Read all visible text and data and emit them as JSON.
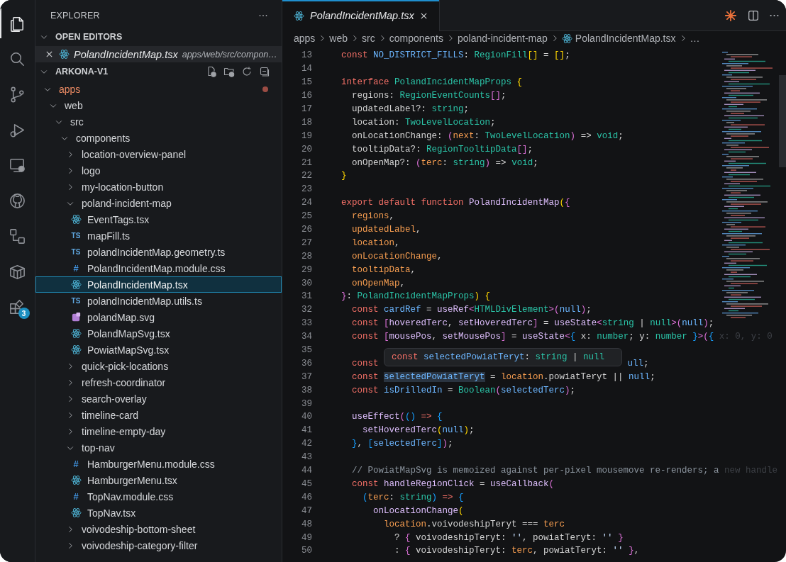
{
  "activity_bar": [
    {
      "kind": "explorer",
      "selected": true
    },
    {
      "kind": "search",
      "selected": false
    },
    {
      "kind": "source-control",
      "selected": false
    },
    {
      "kind": "run-debug",
      "selected": false
    },
    {
      "kind": "remote",
      "selected": false
    },
    {
      "kind": "github",
      "selected": false
    },
    {
      "kind": "diagram",
      "selected": false
    },
    {
      "kind": "package",
      "selected": false
    },
    {
      "kind": "extensions",
      "selected": false,
      "badge": "3"
    }
  ],
  "sidebar": {
    "title": "EXPLORER",
    "open_editors": {
      "title": "OPEN EDITORS",
      "expanded": true,
      "items": [
        {
          "name": "PolandIncidentMap.tsx",
          "path": "apps/web/src/compon…",
          "kind": "tsx"
        }
      ]
    },
    "project": {
      "title": "ARKONA-V1",
      "expanded": true,
      "tree": [
        {
          "name": "apps",
          "kind": "folder",
          "expanded": true,
          "selected": false,
          "modified": true,
          "children": [
            {
              "name": "web",
              "kind": "folder",
              "expanded": true,
              "selected": false,
              "modified": false,
              "children": [
                {
                  "name": "src",
                  "kind": "folder",
                  "expanded": true,
                  "selected": false,
                  "modified": false,
                  "children": [
                    {
                      "name": "components",
                      "kind": "folder",
                      "expanded": true,
                      "selected": false,
                      "modified": false,
                      "children": [
                        {
                          "name": "location-overview-panel",
                          "kind": "folder",
                          "expanded": false,
                          "selected": false,
                          "modified": false
                        },
                        {
                          "name": "logo",
                          "kind": "folder",
                          "expanded": false,
                          "selected": false,
                          "modified": false
                        },
                        {
                          "name": "my-location-button",
                          "kind": "folder",
                          "expanded": false,
                          "selected": false,
                          "modified": false
                        },
                        {
                          "name": "poland-incident-map",
                          "kind": "folder",
                          "expanded": true,
                          "selected": false,
                          "modified": false,
                          "children": [
                            {
                              "name": "EventTags.tsx",
                              "kind": "tsx",
                              "selected": false,
                              "modified": false
                            },
                            {
                              "name": "mapFill.ts",
                              "kind": "ts",
                              "icon_text": "TS",
                              "selected": false,
                              "modified": false
                            },
                            {
                              "name": "polandIncidentMap.geometry.ts",
                              "kind": "ts",
                              "icon_text": "TS",
                              "selected": false,
                              "modified": false
                            },
                            {
                              "name": "PolandIncidentMap.module.css",
                              "kind": "css",
                              "icon_text": "#",
                              "selected": false,
                              "modified": false
                            },
                            {
                              "name": "PolandIncidentMap.tsx",
                              "kind": "tsx",
                              "selected": true,
                              "modified": false
                            },
                            {
                              "name": "polandIncidentMap.utils.ts",
                              "kind": "ts",
                              "icon_text": "TS",
                              "selected": false,
                              "modified": false
                            },
                            {
                              "name": "polandMap.svg",
                              "kind": "svg",
                              "selected": false,
                              "modified": false
                            },
                            {
                              "name": "PolandMapSvg.tsx",
                              "kind": "tsx",
                              "selected": false,
                              "modified": false
                            },
                            {
                              "name": "PowiatMapSvg.tsx",
                              "kind": "tsx",
                              "selected": false,
                              "modified": false
                            }
                          ]
                        },
                        {
                          "name": "quick-pick-locations",
                          "kind": "folder",
                          "expanded": false,
                          "selected": false,
                          "modified": false
                        },
                        {
                          "name": "refresh-coordinator",
                          "kind": "folder",
                          "expanded": false,
                          "selected": false,
                          "modified": false
                        },
                        {
                          "name": "search-overlay",
                          "kind": "folder",
                          "expanded": false,
                          "selected": false,
                          "modified": false
                        },
                        {
                          "name": "timeline-card",
                          "kind": "folder",
                          "expanded": false,
                          "selected": false,
                          "modified": false
                        },
                        {
                          "name": "timeline-empty-day",
                          "kind": "folder",
                          "expanded": false,
                          "selected": false,
                          "modified": false
                        },
                        {
                          "name": "top-nav",
                          "kind": "folder",
                          "expanded": true,
                          "selected": false,
                          "modified": false,
                          "children": [
                            {
                              "name": "HamburgerMenu.module.css",
                              "kind": "css",
                              "icon_text": "#",
                              "selected": false,
                              "modified": false
                            },
                            {
                              "name": "HamburgerMenu.tsx",
                              "kind": "tsx",
                              "selected": false,
                              "modified": false
                            },
                            {
                              "name": "TopNav.module.css",
                              "kind": "css",
                              "icon_text": "#",
                              "selected": false,
                              "modified": false
                            },
                            {
                              "name": "TopNav.tsx",
                              "kind": "tsx",
                              "selected": false,
                              "modified": false
                            }
                          ]
                        },
                        {
                          "name": "voivodeship-bottom-sheet",
                          "kind": "folder",
                          "expanded": false,
                          "selected": false,
                          "modified": false
                        },
                        {
                          "name": "voivodeship-category-filter",
                          "kind": "folder",
                          "expanded": false,
                          "selected": false,
                          "modified": false
                        }
                      ]
                    }
                  ]
                }
              ]
            }
          ]
        }
      ]
    }
  },
  "editor": {
    "tabs": [
      {
        "name": "PolandIncidentMap.tsx",
        "kind": "tsx",
        "selected": true
      }
    ],
    "breadcrumbs": [
      {
        "text": "apps",
        "kind": "folder"
      },
      {
        "text": "web",
        "kind": "folder"
      },
      {
        "text": "src",
        "kind": "folder"
      },
      {
        "text": "components",
        "kind": "folder"
      },
      {
        "text": "poland-incident-map",
        "kind": "folder"
      },
      {
        "text": "PolandIncidentMap.tsx",
        "kind": "tsx"
      },
      {
        "text": "…",
        "kind": "more"
      }
    ],
    "lines": [
      {
        "n": "13",
        "tokens": [
          {
            "text": "const ",
            "kind": "kw"
          },
          {
            "text": "NO_DISTRICT_FILLS",
            "kind": "var"
          },
          {
            "text": ": ",
            "kind": "plain"
          },
          {
            "text": "RegionFill",
            "kind": "type"
          },
          {
            "text": "[]",
            "kind": "b1"
          },
          {
            "text": " = ",
            "kind": "plain"
          },
          {
            "text": "[]",
            "kind": "b1"
          },
          {
            "text": ";",
            "kind": "plain"
          }
        ]
      },
      {
        "n": "14"
      },
      {
        "n": "15",
        "tokens": [
          {
            "text": "interface",
            "kind": "kw"
          },
          {
            "text": " PolandIncidentMapProps",
            "kind": "type"
          },
          {
            "text": " {",
            "kind": "b1"
          }
        ]
      },
      {
        "n": "16",
        "tokens": [
          {
            "text": "  regions: ",
            "kind": "plain"
          },
          {
            "text": "RegionEventCounts",
            "kind": "type"
          },
          {
            "text": "[]",
            "kind": "b2"
          },
          {
            "text": ";",
            "kind": "plain"
          }
        ]
      },
      {
        "n": "17",
        "tokens": [
          {
            "text": "  updatedLabel?: ",
            "kind": "plain"
          },
          {
            "text": "string",
            "kind": "type"
          },
          {
            "text": ";",
            "kind": "plain"
          }
        ]
      },
      {
        "n": "18",
        "tokens": [
          {
            "text": "  location: ",
            "kind": "plain"
          },
          {
            "text": "TwoLevelLocation",
            "kind": "type"
          },
          {
            "text": ";",
            "kind": "plain"
          }
        ]
      },
      {
        "n": "19",
        "tokens": [
          {
            "text": "  onLocationChange: ",
            "kind": "plain"
          },
          {
            "text": "(",
            "kind": "b2"
          },
          {
            "text": "next",
            "kind": "param"
          },
          {
            "text": ": ",
            "kind": "plain"
          },
          {
            "text": "TwoLevelLocation",
            "kind": "type"
          },
          {
            "text": ")",
            "kind": "b2"
          },
          {
            "text": " => ",
            "kind": "plain"
          },
          {
            "text": "void",
            "kind": "type"
          },
          {
            "text": ";",
            "kind": "plain"
          }
        ]
      },
      {
        "n": "20",
        "tokens": [
          {
            "text": "  tooltipData?: ",
            "kind": "plain"
          },
          {
            "text": "RegionTooltipData",
            "kind": "type"
          },
          {
            "text": "[]",
            "kind": "b2"
          },
          {
            "text": ";",
            "kind": "plain"
          }
        ]
      },
      {
        "n": "21",
        "tokens": [
          {
            "text": "  onOpenMap?: ",
            "kind": "plain"
          },
          {
            "text": "(",
            "kind": "b2"
          },
          {
            "text": "terc",
            "kind": "param"
          },
          {
            "text": ": ",
            "kind": "plain"
          },
          {
            "text": "string",
            "kind": "type"
          },
          {
            "text": ")",
            "kind": "b2"
          },
          {
            "text": " => ",
            "kind": "plain"
          },
          {
            "text": "void",
            "kind": "type"
          },
          {
            "text": ";",
            "kind": "plain"
          }
        ]
      },
      {
        "n": "22",
        "tokens": [
          {
            "text": "}",
            "kind": "b1"
          }
        ]
      },
      {
        "n": "23"
      },
      {
        "n": "24",
        "tokens": [
          {
            "text": "export default function ",
            "kind": "kw"
          },
          {
            "text": "PolandIncidentMap",
            "kind": "fn"
          },
          {
            "text": "(",
            "kind": "b1"
          },
          {
            "text": "{",
            "kind": "b2"
          }
        ]
      },
      {
        "n": "25",
        "tokens": [
          {
            "text": "  regions",
            "kind": "param"
          },
          {
            "text": ",",
            "kind": "plain"
          }
        ]
      },
      {
        "n": "26",
        "tokens": [
          {
            "text": "  updatedLabel",
            "kind": "param"
          },
          {
            "text": ",",
            "kind": "plain"
          }
        ]
      },
      {
        "n": "27",
        "tokens": [
          {
            "text": "  location",
            "kind": "param"
          },
          {
            "text": ",",
            "kind": "plain"
          }
        ]
      },
      {
        "n": "28",
        "tokens": [
          {
            "text": "  onLocationChange",
            "kind": "param"
          },
          {
            "text": ",",
            "kind": "plain"
          }
        ]
      },
      {
        "n": "29",
        "tokens": [
          {
            "text": "  tooltipData",
            "kind": "param"
          },
          {
            "text": ",",
            "kind": "plain"
          }
        ]
      },
      {
        "n": "30",
        "tokens": [
          {
            "text": "  onOpenMap",
            "kind": "param"
          },
          {
            "text": ",",
            "kind": "plain"
          }
        ]
      },
      {
        "n": "31",
        "tokens": [
          {
            "text": "}",
            "kind": "b2"
          },
          {
            "text": ": ",
            "kind": "plain"
          },
          {
            "text": "PolandIncidentMapProps",
            "kind": "type"
          },
          {
            "text": ")",
            "kind": "b1"
          },
          {
            "text": " {",
            "kind": "b1"
          }
        ]
      },
      {
        "n": "32",
        "tokens": [
          {
            "text": "  const",
            "kind": "kw"
          },
          {
            "text": " cardRef",
            "kind": "var"
          },
          {
            "text": " = ",
            "kind": "plain"
          },
          {
            "text": "useRef",
            "kind": "fn"
          },
          {
            "text": "<",
            "kind": "b2"
          },
          {
            "text": "HTMLDivElement",
            "kind": "type"
          },
          {
            "text": ">(",
            "kind": "b2"
          },
          {
            "text": "null",
            "kind": "var"
          },
          {
            "text": ")",
            "kind": "b2"
          },
          {
            "text": ";",
            "kind": "plain"
          }
        ]
      },
      {
        "n": "33",
        "tokens": [
          {
            "text": "  const ",
            "kind": "kw"
          },
          {
            "text": "[",
            "kind": "b2"
          },
          {
            "text": "hoveredTerc",
            "kind": "fn"
          },
          {
            "text": ", ",
            "kind": "plain"
          },
          {
            "text": "setHoveredTerc",
            "kind": "fn"
          },
          {
            "text": "]",
            "kind": "b2"
          },
          {
            "text": " = ",
            "kind": "plain"
          },
          {
            "text": "useState",
            "kind": "fn"
          },
          {
            "text": "<",
            "kind": "b2"
          },
          {
            "text": "string",
            "kind": "type"
          },
          {
            "text": " | ",
            "kind": "plain"
          },
          {
            "text": "null",
            "kind": "type"
          },
          {
            "text": ">(",
            "kind": "b2"
          },
          {
            "text": "null",
            "kind": "var"
          },
          {
            "text": ")",
            "kind": "b2"
          },
          {
            "text": ";",
            "kind": "plain"
          }
        ]
      },
      {
        "n": "34",
        "tokens": [
          {
            "text": "  const ",
            "kind": "kw"
          },
          {
            "text": "[",
            "kind": "b2"
          },
          {
            "text": "mousePos",
            "kind": "fn"
          },
          {
            "text": ", ",
            "kind": "plain"
          },
          {
            "text": "setMousePos",
            "kind": "fn"
          },
          {
            "text": "]",
            "kind": "b2"
          },
          {
            "text": " = ",
            "kind": "plain"
          },
          {
            "text": "useState",
            "kind": "fn"
          },
          {
            "text": "<",
            "kind": "b2"
          },
          {
            "text": "{",
            "kind": "b3"
          },
          {
            "text": " x: ",
            "kind": "plain"
          },
          {
            "text": "number",
            "kind": "type"
          },
          {
            "text": "; y: ",
            "kind": "plain"
          },
          {
            "text": "number",
            "kind": "type"
          },
          {
            "text": " }",
            "kind": "b3"
          },
          {
            "text": ">(",
            "kind": "b2"
          },
          {
            "text": "{",
            "kind": "b3"
          },
          {
            "text": " x: 0, y: 0",
            "kind": "faded"
          }
        ]
      },
      {
        "n": "35"
      },
      {
        "n": "36",
        "tokens": [
          {
            "text": "  const",
            "kind": "kw"
          },
          {
            "text": "ull",
            "kind": "covered-var"
          },
          {
            "text": ";",
            "kind": "plain"
          }
        ]
      },
      {
        "n": "37",
        "tokens": [
          {
            "text": "  const ",
            "kind": "kw"
          },
          {
            "text": "selectedPowiatTeryt",
            "kind": "var-hl"
          },
          {
            "text": " = ",
            "kind": "plain"
          },
          {
            "text": "location",
            "kind": "param"
          },
          {
            "text": ".powiatTeryt || ",
            "kind": "plain"
          },
          {
            "text": "null",
            "kind": "var"
          },
          {
            "text": ";",
            "kind": "plain"
          }
        ]
      },
      {
        "n": "38",
        "tokens": [
          {
            "text": "  const ",
            "kind": "kw"
          },
          {
            "text": "isDrilledIn",
            "kind": "var"
          },
          {
            "text": " = ",
            "kind": "plain"
          },
          {
            "text": "Boolean",
            "kind": "type"
          },
          {
            "text": "(",
            "kind": "b2"
          },
          {
            "text": "selectedTerc",
            "kind": "var"
          },
          {
            "text": ")",
            "kind": "b2"
          },
          {
            "text": ";",
            "kind": "plain"
          }
        ]
      },
      {
        "n": "39"
      },
      {
        "n": "40",
        "tokens": [
          {
            "text": "  useEffect",
            "kind": "fn"
          },
          {
            "text": "(",
            "kind": "b2"
          },
          {
            "text": "()",
            "kind": "b3"
          },
          {
            "text": " => ",
            "kind": "kw"
          },
          {
            "text": "{",
            "kind": "b3"
          }
        ]
      },
      {
        "n": "41",
        "tokens": [
          {
            "text": "    setHoveredTerc",
            "kind": "fn"
          },
          {
            "text": "(",
            "kind": "b1"
          },
          {
            "text": "null",
            "kind": "var"
          },
          {
            "text": ")",
            "kind": "b1"
          },
          {
            "text": ";",
            "kind": "plain"
          }
        ]
      },
      {
        "n": "42",
        "tokens": [
          {
            "text": "  }",
            "kind": "b3"
          },
          {
            "text": ", ",
            "kind": "plain"
          },
          {
            "text": "[",
            "kind": "b3"
          },
          {
            "text": "selectedTerc",
            "kind": "var"
          },
          {
            "text": "]",
            "kind": "b3"
          },
          {
            "text": ")",
            "kind": "b2"
          },
          {
            "text": ";",
            "kind": "plain"
          }
        ]
      },
      {
        "n": "43"
      },
      {
        "n": "44",
        "tokens": [
          {
            "text": "  // PowiatMapSvg is memoized against per-pixel mousemove re-renders; a",
            "kind": "cmt"
          },
          {
            "text": " new handle",
            "kind": "faded"
          }
        ]
      },
      {
        "n": "45",
        "tokens": [
          {
            "text": "  const ",
            "kind": "kw"
          },
          {
            "text": "handleRegionClick",
            "kind": "fn"
          },
          {
            "text": " = ",
            "kind": "plain"
          },
          {
            "text": "useCallback",
            "kind": "fn"
          },
          {
            "text": "(",
            "kind": "b2"
          }
        ]
      },
      {
        "n": "46",
        "tokens": [
          {
            "text": "    (",
            "kind": "b3"
          },
          {
            "text": "terc",
            "kind": "param"
          },
          {
            "text": ": ",
            "kind": "plain"
          },
          {
            "text": "string",
            "kind": "type"
          },
          {
            "text": ")",
            "kind": "b3"
          },
          {
            "text": " => ",
            "kind": "kw"
          },
          {
            "text": "{",
            "kind": "b3"
          }
        ]
      },
      {
        "n": "47",
        "tokens": [
          {
            "text": "      onLocationChange",
            "kind": "fn"
          },
          {
            "text": "(",
            "kind": "b1"
          }
        ]
      },
      {
        "n": "48",
        "tokens": [
          {
            "text": "        location",
            "kind": "param"
          },
          {
            "text": ".voivodeshipTeryt === ",
            "kind": "plain"
          },
          {
            "text": "terc",
            "kind": "param"
          }
        ]
      },
      {
        "n": "49",
        "tokens": [
          {
            "text": "          ? ",
            "kind": "plain"
          },
          {
            "text": "{",
            "kind": "b2"
          },
          {
            "text": " voivodeshipTeryt: ",
            "kind": "plain"
          },
          {
            "text": "''",
            "kind": "str"
          },
          {
            "text": ", powiatTeryt: ",
            "kind": "plain"
          },
          {
            "text": "''",
            "kind": "str"
          },
          {
            "text": " }",
            "kind": "b2"
          }
        ]
      },
      {
        "n": "50",
        "tokens": [
          {
            "text": "          : ",
            "kind": "plain"
          },
          {
            "text": "{",
            "kind": "b2"
          },
          {
            "text": " voivodeshipTeryt: ",
            "kind": "plain"
          },
          {
            "text": "terc",
            "kind": "param"
          },
          {
            "text": ", powiatTeryt: ",
            "kind": "plain"
          },
          {
            "text": "''",
            "kind": "str"
          },
          {
            "text": " }",
            "kind": "b2"
          },
          {
            "text": ",",
            "kind": "plain"
          }
        ]
      }
    ],
    "hover": {
      "tokens": [
        {
          "text": "const ",
          "kind": "kw"
        },
        {
          "text": "selectedPowiatTeryt",
          "kind": "var"
        },
        {
          "text": ": ",
          "kind": "plain"
        },
        {
          "text": "string",
          "kind": "type"
        },
        {
          "text": " | ",
          "kind": "plain"
        },
        {
          "text": "null",
          "kind": "type"
        }
      ]
    }
  }
}
